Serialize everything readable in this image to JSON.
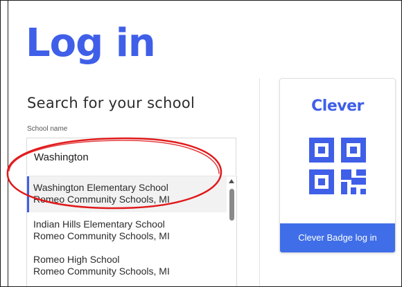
{
  "page": {
    "title": "Log in"
  },
  "search": {
    "heading": "Search for your school",
    "field_label": "School name",
    "value": "Washington"
  },
  "results": [
    {
      "name": "Washington Elementary School",
      "district": "Romeo Community Schools, MI",
      "highlighted": true
    },
    {
      "name": "Indian Hills Elementary School",
      "district": "Romeo Community Schools, MI",
      "highlighted": false
    },
    {
      "name": "Romeo High School",
      "district": "Romeo Community Schools, MI",
      "highlighted": false
    }
  ],
  "badge": {
    "brand": "Clever",
    "button_label": "Clever Badge log in",
    "icon": "qr-code-icon"
  },
  "colors": {
    "accent": "#3f5fe8",
    "button": "#3f6ee8",
    "annotation": "#e0191b"
  }
}
